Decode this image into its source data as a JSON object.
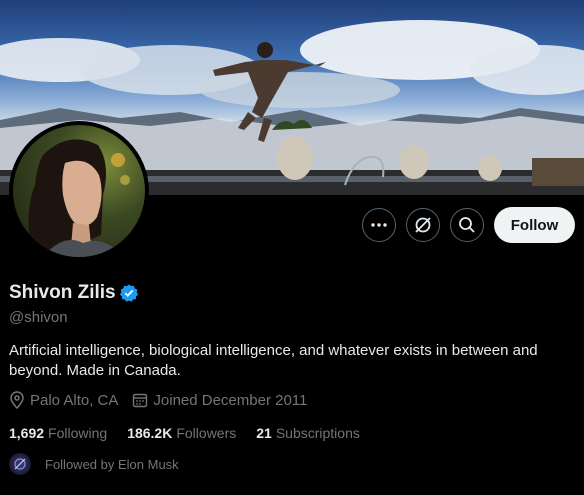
{
  "profile": {
    "name": "Shivon Zilis",
    "handle": "@shivon",
    "bio": "Artificial intelligence, biological intelligence, and whatever exists in between and beyond. Made in Canada.",
    "location": "Palo Alto, CA",
    "joined": "Joined December 2011"
  },
  "stats": {
    "following_count": "1,692",
    "following_label": "Following",
    "followers_count": "186.2K",
    "followers_label": "Followers",
    "subscriptions_count": "21",
    "subscriptions_label": "Subscriptions"
  },
  "followed_by": "Followed by Elon Musk",
  "actions": {
    "follow_label": "Follow",
    "more_icon": "more-icon",
    "grok_icon": "grok-icon",
    "search_icon": "search-icon"
  },
  "colors": {
    "background": "#000000",
    "text": "#e7e9ea",
    "secondary_text": "#71767b",
    "verified": "#1d9bf0",
    "follow_button_bg": "#eff3f4",
    "border": "#536471"
  }
}
